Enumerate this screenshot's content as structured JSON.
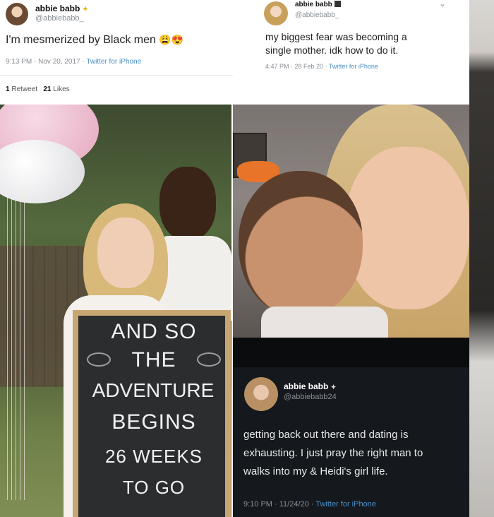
{
  "tweet_1": {
    "name": "abbie babb",
    "name_badge": "✦",
    "handle": "@abbiebabb_",
    "text": "I'm mesmerized by Black men",
    "emoji": "😩😍",
    "time": "9:13 PM · Nov 20, 2017 · ",
    "source": "Twitter for iPhone",
    "retweets_count": "1",
    "retweets_label": "Retweet",
    "likes_count": "21",
    "likes_label": "Likes"
  },
  "tweet_2": {
    "name": "abbie babb",
    "handle": "@abbiebabb_",
    "text_line1": "my biggest fear was becoming a",
    "text_line2": "single mother. idk how to do it.",
    "time": "4:47 PM · 28 Feb 20 · ",
    "source": "Twitter for iPhone",
    "chevron": "⌄"
  },
  "tweet_3": {
    "name": "abbie babb",
    "name_badge": "✦",
    "handle": "@abbiebabb24",
    "text_line1": "getting back out there and dating is",
    "text_line2": "exhausting. I just pray the right man to",
    "text_line3": "walks into my & Heidi's girl life.",
    "time": "9:10 PM · 11/24/20 · ",
    "source": "Twitter for iPhone"
  },
  "chalkboard": {
    "line1": "AND SO",
    "line2": "THE",
    "line3": "ADVENTURE",
    "line4": "BEGINS",
    "line5": "26 WEEKS",
    "line6": "TO GO"
  },
  "colors": {
    "dark_tweet_bg": "#15181c",
    "link_blue": "#4a90c8",
    "chalk_board": "#2b2d2f",
    "board_frame": "#c8a672"
  }
}
